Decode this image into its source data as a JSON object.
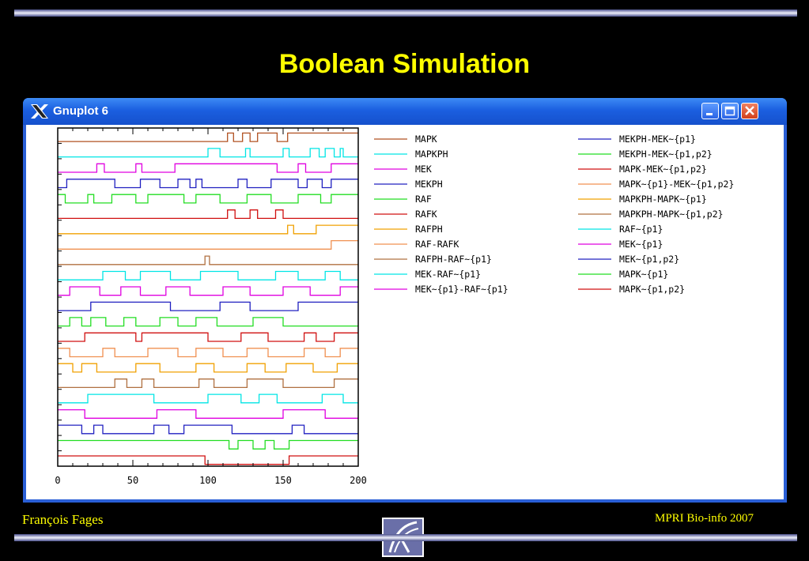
{
  "slide": {
    "title": "Boolean Simulation",
    "footer_left": "François Fages",
    "footer_right": "MPRI Bio-info  2007"
  },
  "window": {
    "title": "Gnuplot 6",
    "titlebar_color": "#1b5fe0"
  },
  "chart_data": {
    "type": "line",
    "title": "",
    "xlabel": "",
    "ylabel": "",
    "xlim": [
      0,
      200
    ],
    "x_ticks": [
      0,
      50,
      100,
      150,
      200
    ],
    "grid": false,
    "legend_placement": "right",
    "series": [
      {
        "name": "MAPK",
        "color": "#b05020",
        "x": [
          0,
          113,
          113,
          117,
          117,
          123,
          123,
          128,
          128,
          133,
          133,
          146,
          146,
          153,
          153,
          200
        ],
        "y": [
          0,
          0,
          1,
          1,
          0,
          0,
          1,
          1,
          0,
          0,
          1,
          1,
          0,
          0,
          1,
          1
        ]
      },
      {
        "name": "MAPKPH",
        "color": "#00e5e5",
        "x": [
          0,
          100,
          100,
          108,
          108,
          125,
          125,
          128,
          128,
          150,
          150,
          154,
          154,
          168,
          168,
          174,
          174,
          178,
          178,
          184,
          184,
          188,
          188,
          190,
          190,
          200
        ],
        "y": [
          0,
          0,
          1,
          1,
          0,
          0,
          1,
          1,
          0,
          0,
          1,
          1,
          0,
          0,
          1,
          1,
          0,
          0,
          1,
          1,
          0,
          0,
          1,
          1,
          0,
          0
        ]
      },
      {
        "name": "MEK",
        "color": "#e000e0",
        "x": [
          0,
          26,
          26,
          31,
          31,
          52,
          52,
          56,
          56,
          78,
          78,
          146,
          146,
          160,
          160,
          165,
          165,
          182,
          182,
          200
        ],
        "y": [
          0,
          0,
          1,
          1,
          0,
          0,
          1,
          1,
          0,
          0,
          1,
          1,
          0,
          0,
          1,
          1,
          0,
          0,
          1,
          1
        ]
      },
      {
        "name": "MEKPH",
        "color": "#2020c0",
        "x": [
          0,
          6,
          6,
          38,
          38,
          55,
          55,
          68,
          68,
          80,
          80,
          88,
          88,
          92,
          92,
          96,
          96,
          120,
          120,
          126,
          126,
          142,
          142,
          160,
          160,
          166,
          166,
          176,
          176,
          182,
          182,
          200
        ],
        "y": [
          0,
          0,
          1,
          1,
          0,
          0,
          1,
          1,
          0,
          0,
          1,
          1,
          0,
          0,
          1,
          1,
          0,
          0,
          1,
          1,
          0,
          0,
          1,
          1,
          0,
          0,
          1,
          1,
          0,
          0,
          1,
          1
        ]
      },
      {
        "name": "RAF",
        "color": "#22dd22",
        "x": [
          0,
          5,
          5,
          20,
          20,
          24,
          24,
          36,
          36,
          52,
          52,
          60,
          60,
          84,
          84,
          92,
          92,
          108,
          108,
          126,
          126,
          142,
          142,
          160,
          160,
          175,
          175,
          182,
          182,
          200
        ],
        "y": [
          1,
          1,
          0,
          0,
          1,
          1,
          0,
          0,
          1,
          1,
          0,
          0,
          1,
          1,
          0,
          0,
          1,
          1,
          0,
          0,
          1,
          1,
          0,
          0,
          1,
          1,
          0,
          0,
          1,
          1
        ]
      },
      {
        "name": "RAFK",
        "color": "#d01010",
        "x": [
          0,
          113,
          113,
          118,
          118,
          128,
          128,
          133,
          133,
          145,
          145,
          150,
          150,
          200
        ],
        "y": [
          0,
          0,
          1,
          1,
          0,
          0,
          1,
          1,
          0,
          0,
          1,
          1,
          0,
          0
        ]
      },
      {
        "name": "RAFPH",
        "color": "#f0a000",
        "x": [
          0,
          153,
          153,
          157,
          157,
          172,
          172,
          200
        ],
        "y": [
          0,
          0,
          1,
          1,
          0,
          0,
          1,
          1
        ]
      },
      {
        "name": "RAF-RAFK",
        "color": "#f09050",
        "x": [
          0,
          182,
          182,
          200
        ],
        "y": [
          0,
          0,
          1,
          1
        ]
      },
      {
        "name": "RAFPH-RAF~{p1}",
        "color": "#b07040",
        "x": [
          0,
          98,
          98,
          101,
          101,
          200
        ],
        "y": [
          0,
          0,
          1,
          1,
          0,
          0
        ]
      },
      {
        "name": "MEK-RAF~{p1}",
        "color": "#00e5e5",
        "x": [
          0,
          30,
          30,
          45,
          45,
          55,
          55,
          75,
          75,
          95,
          95,
          120,
          120,
          145,
          145,
          160,
          160,
          178,
          178,
          188,
          188,
          200
        ],
        "y": [
          0,
          0,
          1,
          1,
          0,
          0,
          1,
          1,
          0,
          0,
          1,
          1,
          0,
          0,
          1,
          1,
          0,
          0,
          1,
          1,
          0,
          0
        ]
      },
      {
        "name": "MEK~{p1}-RAF~{p1}",
        "color": "#e000e0",
        "x": [
          0,
          8,
          8,
          28,
          28,
          42,
          42,
          55,
          55,
          72,
          72,
          88,
          88,
          110,
          110,
          128,
          128,
          150,
          150,
          168,
          168,
          188,
          188,
          200
        ],
        "y": [
          0,
          0,
          1,
          1,
          0,
          0,
          1,
          1,
          0,
          0,
          1,
          1,
          0,
          0,
          1,
          1,
          0,
          0,
          1,
          1,
          0,
          0,
          1,
          1
        ]
      },
      {
        "name": "MEKPH-MEK~{p1}",
        "color": "#2020c0",
        "x": [
          0,
          22,
          22,
          75,
          75,
          108,
          108,
          128,
          128,
          160,
          160,
          200
        ],
        "y": [
          0,
          0,
          1,
          1,
          0,
          0,
          1,
          1,
          0,
          0,
          1,
          1
        ]
      },
      {
        "name": "MEKPH-MEK~{p1,p2}",
        "color": "#22dd22",
        "x": [
          0,
          8,
          8,
          16,
          16,
          22,
          22,
          32,
          32,
          44,
          44,
          52,
          52,
          68,
          68,
          80,
          80,
          92,
          92,
          106,
          106,
          130,
          130,
          150,
          150,
          200
        ],
        "y": [
          0,
          0,
          1,
          1,
          0,
          0,
          1,
          1,
          0,
          0,
          1,
          1,
          0,
          0,
          1,
          1,
          0,
          0,
          1,
          1,
          0,
          0,
          1,
          1,
          0,
          0
        ]
      },
      {
        "name": "MAPK-MEK~{p1,p2}",
        "color": "#d01010",
        "x": [
          0,
          18,
          18,
          52,
          52,
          56,
          56,
          100,
          100,
          122,
          122,
          140,
          140,
          164,
          164,
          172,
          172,
          184,
          184,
          200
        ],
        "y": [
          0,
          0,
          1,
          1,
          0,
          0,
          1,
          1,
          0,
          0,
          1,
          1,
          0,
          0,
          1,
          1,
          0,
          0,
          1,
          1
        ]
      },
      {
        "name": "MAPK~{p1}-MEK~{p1,p2}",
        "color": "#f09050",
        "x": [
          0,
          8,
          8,
          30,
          30,
          38,
          38,
          60,
          60,
          80,
          80,
          92,
          92,
          110,
          110,
          126,
          126,
          140,
          140,
          164,
          164,
          178,
          178,
          188,
          188,
          200
        ],
        "y": [
          1,
          1,
          0,
          0,
          1,
          1,
          0,
          0,
          1,
          1,
          0,
          0,
          1,
          1,
          0,
          0,
          1,
          1,
          0,
          0,
          1,
          1,
          0,
          0,
          1,
          1
        ]
      },
      {
        "name": "MAPKPH-MAPK~{p1}",
        "color": "#f0a000",
        "x": [
          0,
          10,
          10,
          16,
          16,
          26,
          26,
          52,
          52,
          68,
          68,
          92,
          92,
          104,
          104,
          126,
          126,
          138,
          138,
          152,
          152,
          170,
          170,
          186,
          186,
          200
        ],
        "y": [
          1,
          1,
          0,
          0,
          1,
          1,
          0,
          0,
          1,
          1,
          0,
          0,
          1,
          1,
          0,
          0,
          1,
          1,
          0,
          0,
          1,
          1,
          0,
          0,
          1,
          1
        ]
      },
      {
        "name": "MAPKPH-MAPK~{p1,p2}",
        "color": "#b07040",
        "x": [
          0,
          38,
          38,
          46,
          46,
          56,
          56,
          64,
          64,
          94,
          94,
          104,
          104,
          126,
          126,
          150,
          150,
          184,
          184,
          200
        ],
        "y": [
          0,
          0,
          1,
          1,
          0,
          0,
          1,
          1,
          0,
          0,
          1,
          1,
          0,
          0,
          1,
          1,
          0,
          0,
          1,
          1
        ]
      },
      {
        "name": "RAF~{p1}",
        "color": "#00e5e5",
        "x": [
          0,
          20,
          20,
          64,
          64,
          100,
          100,
          122,
          122,
          134,
          134,
          146,
          146,
          176,
          176,
          190,
          190,
          200
        ],
        "y": [
          0,
          0,
          1,
          1,
          0,
          0,
          1,
          1,
          0,
          0,
          1,
          1,
          0,
          0,
          1,
          1,
          0,
          0
        ]
      },
      {
        "name": "MEK~{p1}",
        "color": "#e000e0",
        "x": [
          0,
          18,
          18,
          66,
          66,
          92,
          92,
          150,
          150,
          178,
          178,
          200
        ],
        "y": [
          1,
          1,
          0,
          0,
          1,
          1,
          0,
          0,
          1,
          1,
          0,
          0
        ]
      },
      {
        "name": "MEK~{p1,p2}",
        "color": "#2020c0",
        "x": [
          0,
          16,
          16,
          24,
          24,
          30,
          30,
          64,
          64,
          74,
          74,
          84,
          84,
          116,
          116,
          156,
          156,
          164,
          164,
          200
        ],
        "y": [
          1,
          1,
          0,
          0,
          1,
          1,
          0,
          0,
          1,
          1,
          0,
          0,
          1,
          1,
          0,
          0,
          1,
          1,
          0,
          0
        ]
      },
      {
        "name": "MAPK~{p1}",
        "color": "#22dd22",
        "x": [
          0,
          114,
          114,
          120,
          120,
          130,
          130,
          138,
          138,
          144,
          144,
          154,
          154,
          200
        ],
        "y": [
          1,
          1,
          0,
          0,
          1,
          1,
          0,
          0,
          1,
          1,
          0,
          0,
          1,
          1
        ]
      },
      {
        "name": "MAPK~{p1,p2}",
        "color": "#d01010",
        "x": [
          0,
          98,
          98,
          154,
          154,
          200
        ],
        "y": [
          1,
          1,
          0,
          0,
          1,
          1
        ]
      }
    ]
  }
}
